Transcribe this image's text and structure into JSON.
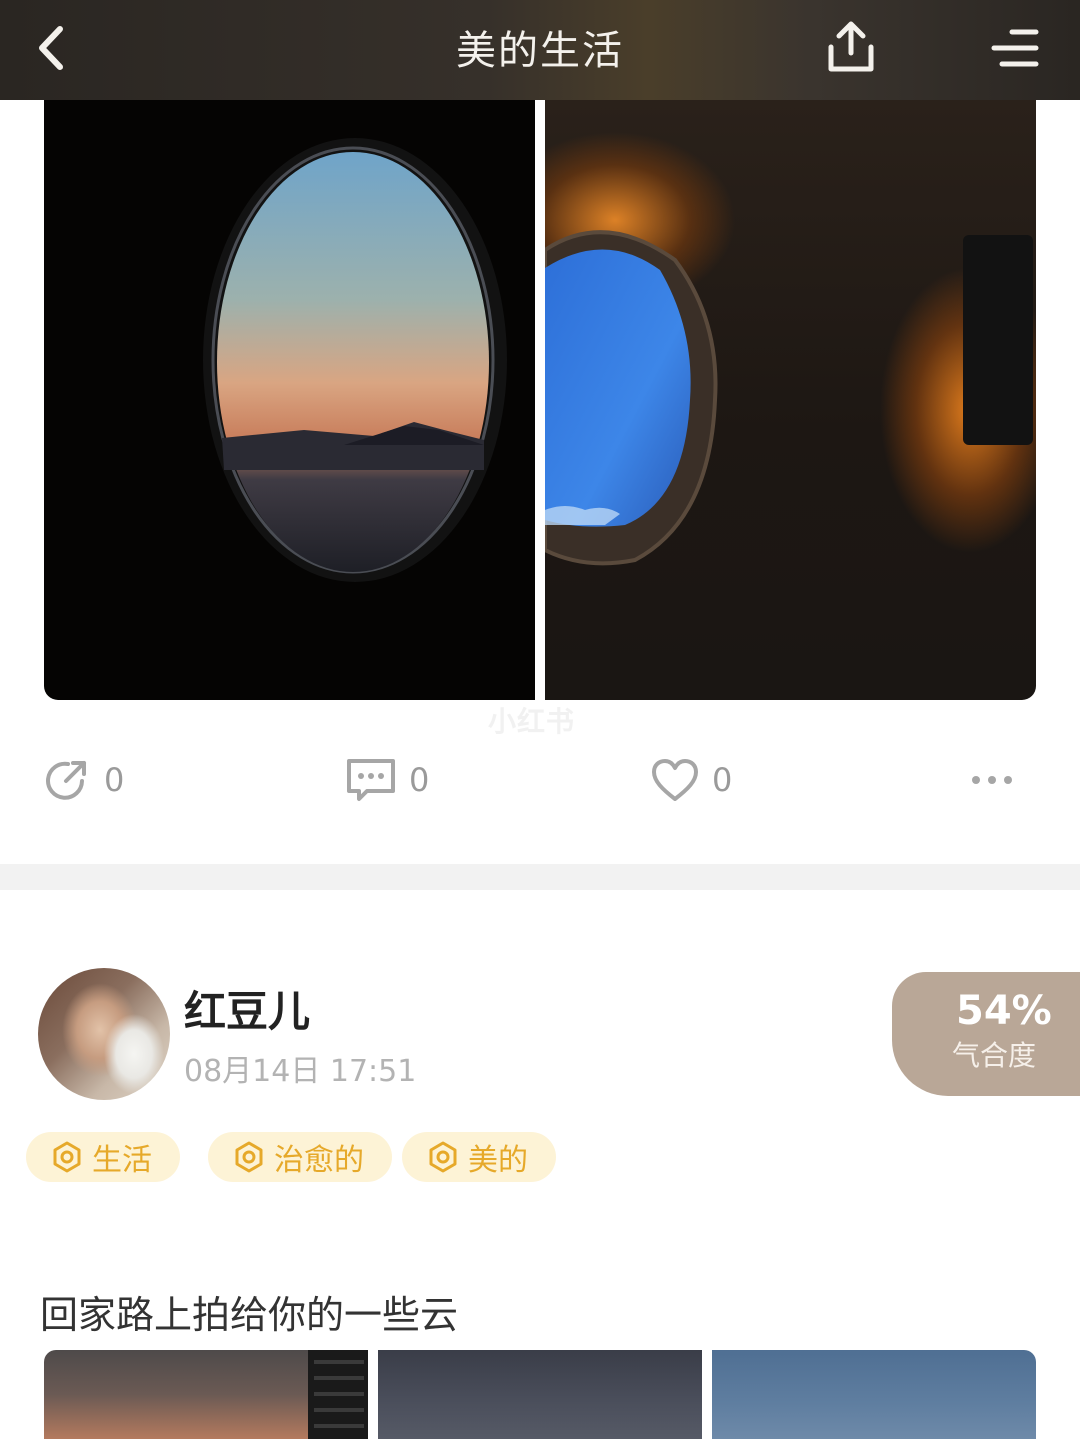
{
  "header": {
    "title": "美的生活",
    "back_icon": "chevron-left-icon",
    "share_icon": "share-upload-icon",
    "menu_icon": "menu-lines-icon"
  },
  "post_top": {
    "images": [
      "airplane-window-sunset-photo",
      "airplane-window-blue-sky-photo"
    ],
    "watermark": "小红书",
    "actions": {
      "repost_count": "0",
      "comment_count": "0",
      "like_count": "0"
    }
  },
  "post": {
    "author": "红豆儿",
    "timestamp": "08月14日 17:51",
    "match": {
      "percent": "54%",
      "label": "气合度"
    },
    "tags": [
      {
        "label": "生活"
      },
      {
        "label": "治愈的"
      },
      {
        "label": "美的"
      }
    ],
    "caption": "回家路上拍给你的一些云"
  },
  "colors": {
    "tag_text": "#e6a92a",
    "tag_bg": "#fdf3d6",
    "badge_bg": "#b9a797",
    "count_gray": "#9a9a9a"
  }
}
